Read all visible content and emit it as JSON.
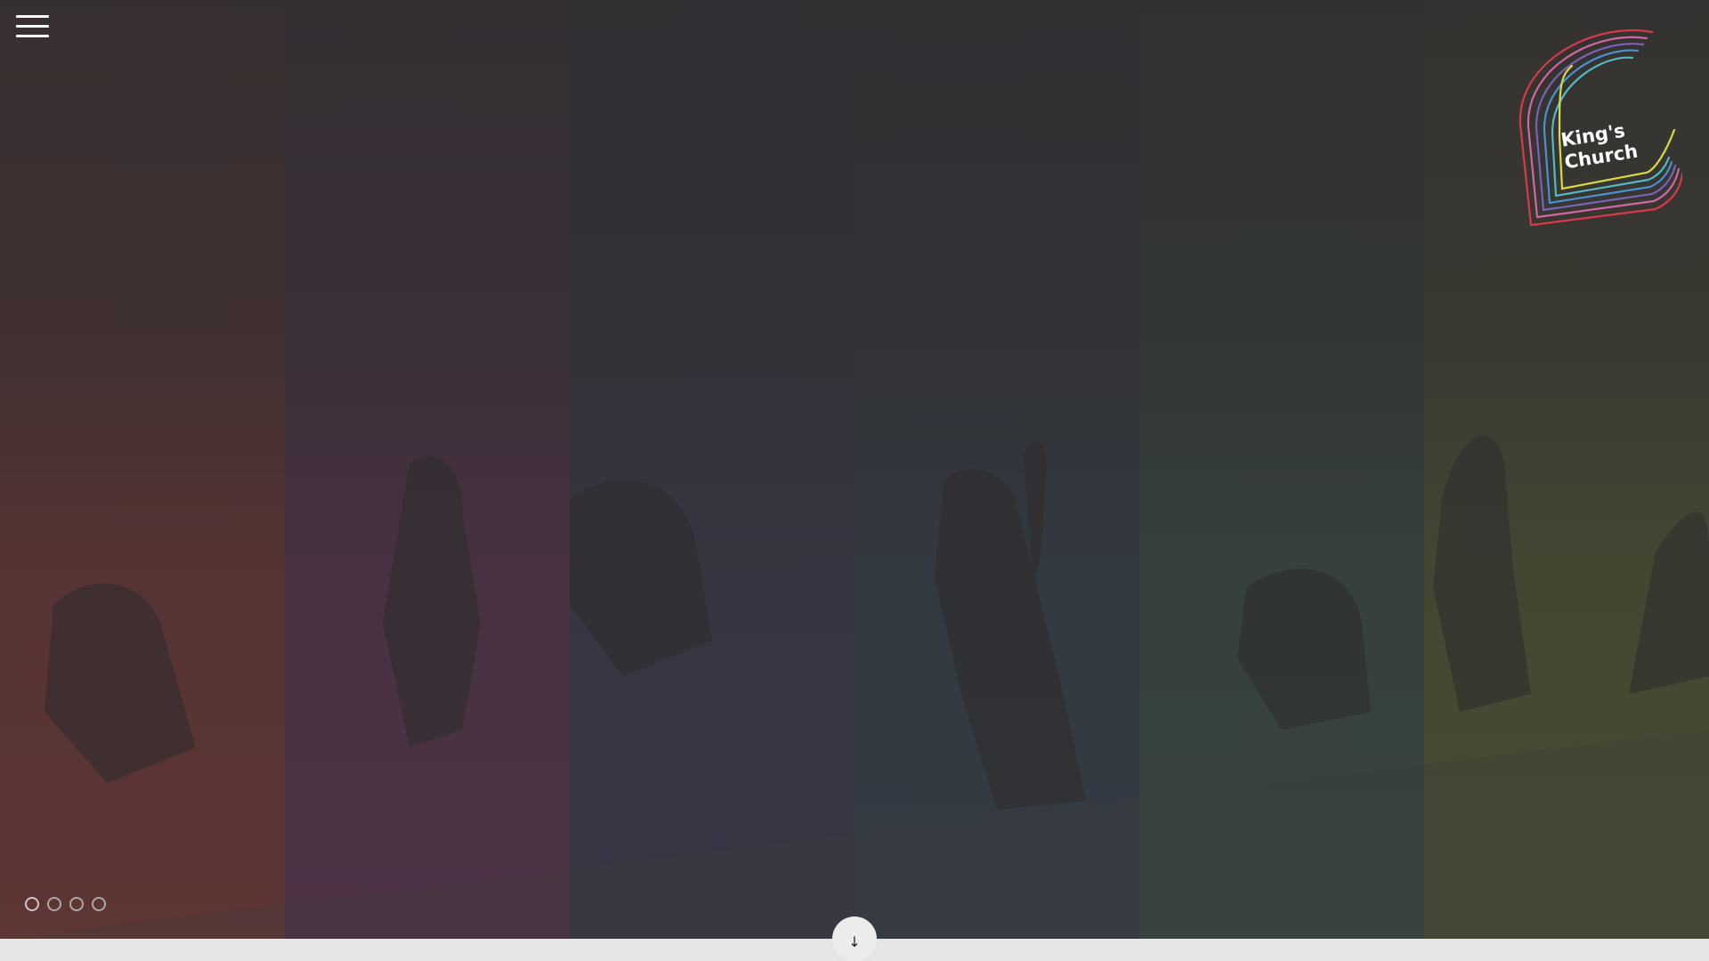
{
  "header": {
    "menu_icon": "hamburger-menu-icon"
  },
  "logo": {
    "line1": "King's",
    "line2": "Church",
    "rainbow_colors": [
      "#d83a4a",
      "#d067a2",
      "#7a62b5",
      "#4d8fd1",
      "#55b8c2",
      "#d9d943"
    ]
  },
  "hero": {
    "background_stripe_colors": [
      "#d64a3d",
      "#9a3d80",
      "#4e4e7c",
      "#3e5f79",
      "#4b7f6b",
      "#8e9a3b"
    ]
  },
  "slider": {
    "count": 4,
    "active_index": 0
  },
  "scroll_button": {
    "icon": "arrow-down-icon",
    "glyph": "↓"
  }
}
